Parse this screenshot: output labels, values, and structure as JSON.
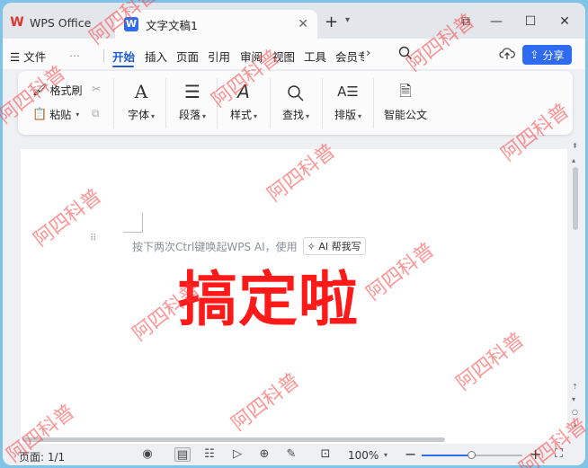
{
  "titlebar": {
    "app_label": "WPS Office",
    "doc_tab_label": "文字文稿1",
    "doc_icon_letter": "W",
    "close_glyph": "✕",
    "new_tab_glyph": "+",
    "window_buttons": {
      "minimize": "—",
      "maximize": "☐",
      "close": "✕"
    }
  },
  "menubar": {
    "file_label": "文件",
    "more_dots": "⋯",
    "tabs": [
      "开始",
      "插入",
      "页面",
      "引用",
      "审阅",
      "视图",
      "工具",
      "会员专"
    ],
    "active_tab": "开始",
    "share_label": "分享"
  },
  "ribbon": {
    "format_painter": "格式刷",
    "paste": "粘贴",
    "font": "字体",
    "paragraph": "段落",
    "style": "样式",
    "find": "查找",
    "layout": "排版",
    "smart_doc": "智能公文"
  },
  "document": {
    "hint_text": "按下两次Ctrl键唤起WPS AI，使用",
    "ai_button_label": "AI 帮我写",
    "big_text": "搞定啦"
  },
  "statusbar": {
    "page_info": "页面: 1/1",
    "zoom_level": "100%",
    "zoom_fraction": 0.5
  },
  "watermark_text": "阿四科普",
  "colors": {
    "accent": "#2f6bf0",
    "big_text": "#ff1a1a",
    "watermark": "#ff3c3c",
    "outer_border": "#7fc4e8"
  }
}
